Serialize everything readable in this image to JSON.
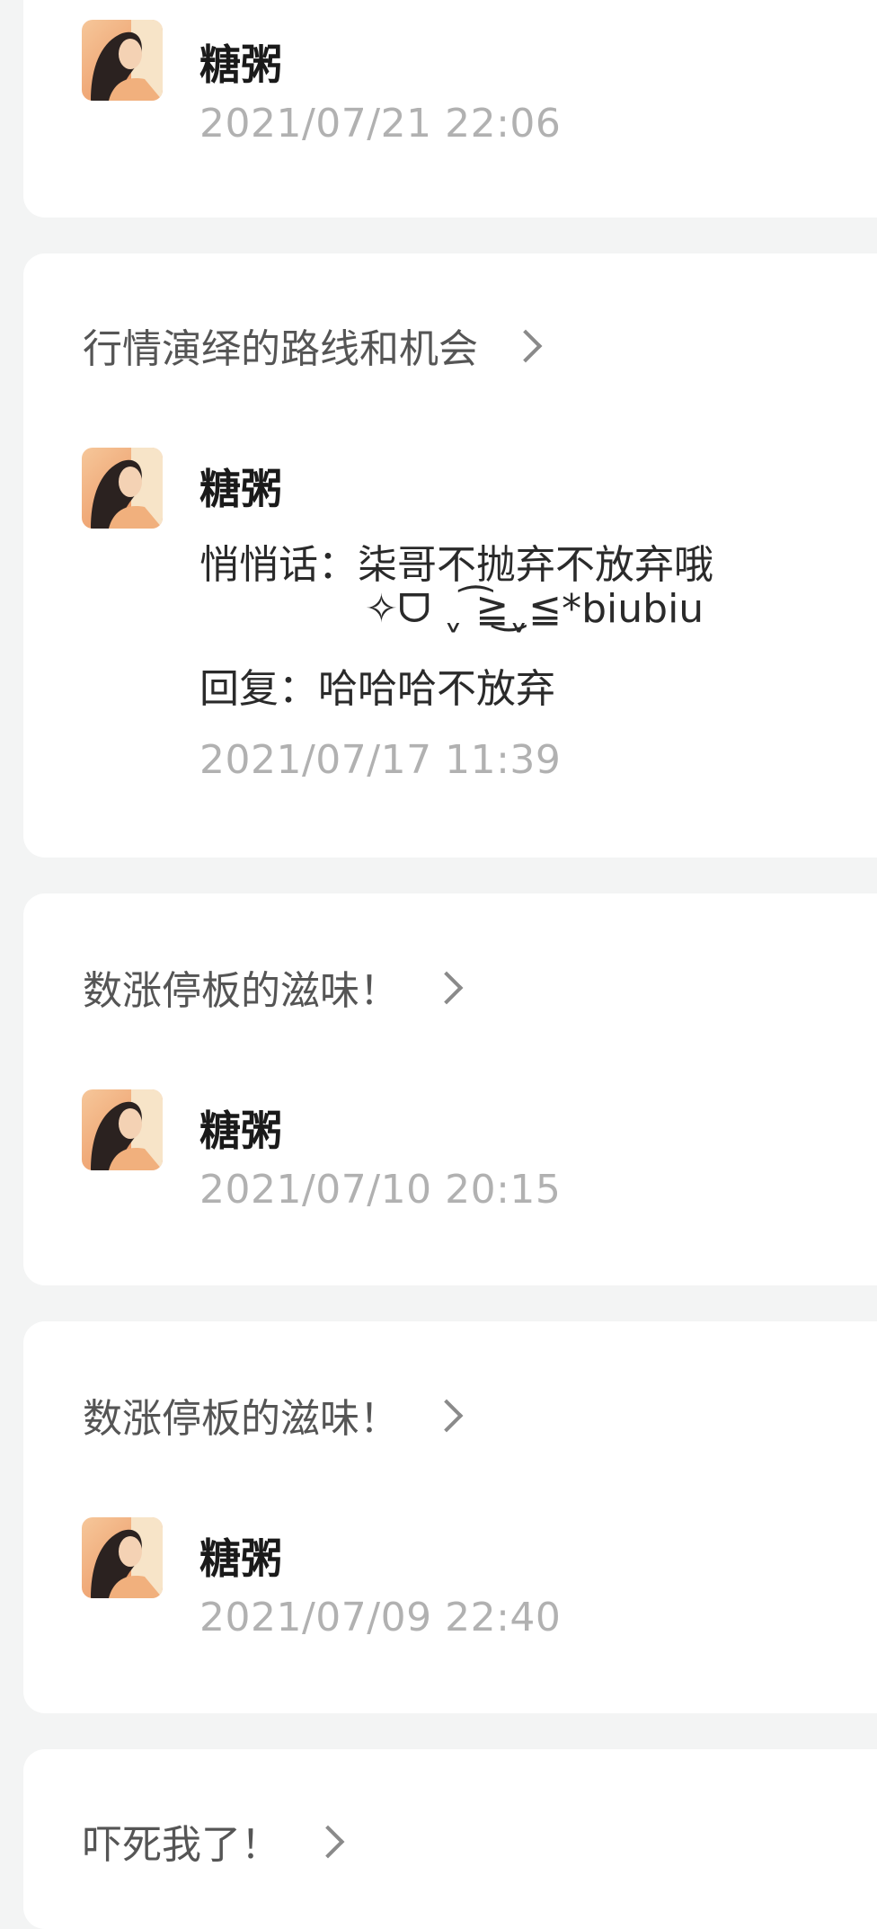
{
  "colors": {
    "background": "#f3f4f4",
    "card": "#ffffff",
    "title_text": "#555555",
    "name_text": "#1a1a1a",
    "time_text": "#b1b1b1",
    "chevron": "#8a8a8a"
  },
  "cards": [
    {
      "title": "",
      "user": {
        "name": "糖粥",
        "avatar_icon": "avatar-girl-portrait-icon"
      },
      "time": "2021/07/21 22:06"
    },
    {
      "title": "行情演绎的路线和机会",
      "user": {
        "name": "糖粥",
        "avatar_icon": "avatar-girl-portrait-icon"
      },
      "message_line_1": "悄悄话：柒哥不抛弃不放弃哦",
      "message_line_2": "✧ᗜ ˬ ͡≧͜ˬ≦*biubiu",
      "reply": "回复：哈哈哈不放弃",
      "time": "2021/07/17 11:39"
    },
    {
      "title": "数涨停板的滋味！",
      "user": {
        "name": "糖粥",
        "avatar_icon": "avatar-girl-portrait-icon"
      },
      "time": "2021/07/10 20:15"
    },
    {
      "title": "数涨停板的滋味！",
      "user": {
        "name": "糖粥",
        "avatar_icon": "avatar-girl-portrait-icon"
      },
      "time": "2021/07/09 22:40"
    },
    {
      "title": "吓死我了！"
    }
  ]
}
